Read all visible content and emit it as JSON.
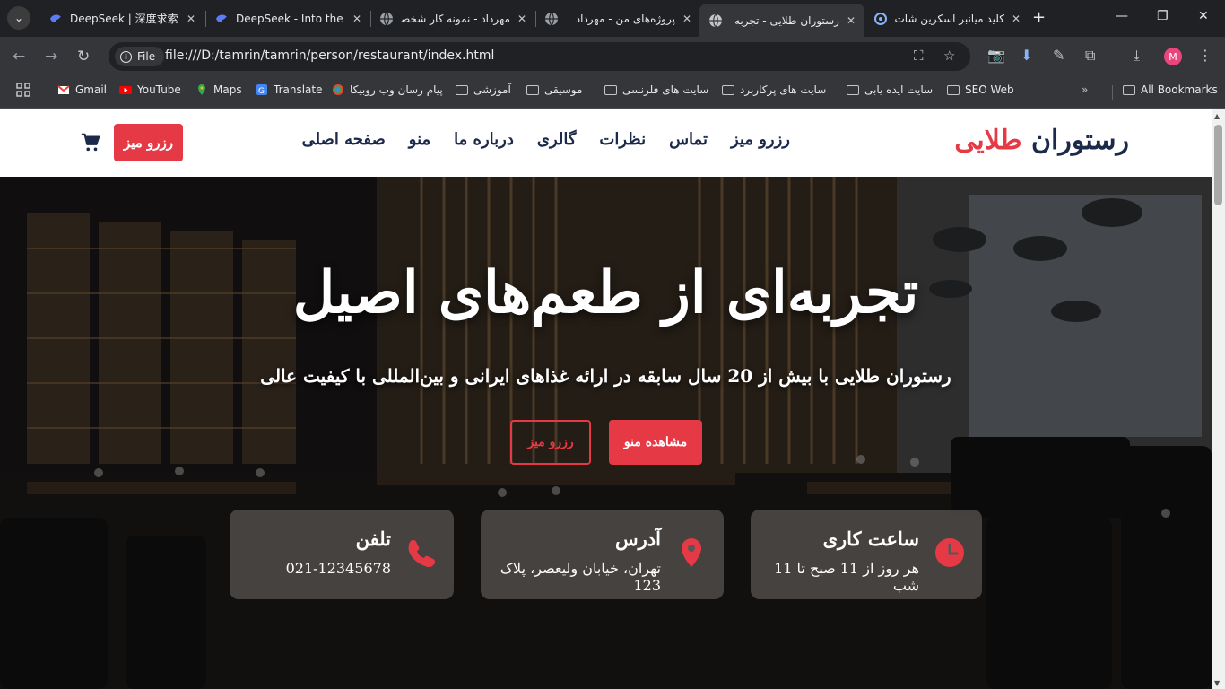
{
  "browser": {
    "tabs": [
      {
        "title": "DeepSeek | 深度求索",
        "icon": "deepseek-icon",
        "active": false
      },
      {
        "title": "DeepSeek - Into the Unknown",
        "icon": "deepseek-icon",
        "active": false
      },
      {
        "title": "مهرداد - نمونه کار شخصی",
        "icon": "globe-icon",
        "active": false
      },
      {
        "title": "پروژه‌های من - مهرداد",
        "icon": "globe-icon",
        "active": false
      },
      {
        "title": "رستوران طلایی - تجربه",
        "icon": "globe-icon",
        "active": true
      },
      {
        "title": "کلید میانبر اسکرین شات",
        "icon": "snip-icon",
        "active": false
      }
    ],
    "url_scheme_label": "File",
    "url": "file:///D:/tamrin/tamrin/person/restaurant/index.html",
    "profile_initial": "M",
    "bookmarks": [
      {
        "label": "Gmail",
        "icon": "gmail-icon"
      },
      {
        "label": "YouTube",
        "icon": "youtube-icon"
      },
      {
        "label": "Maps",
        "icon": "maps-icon"
      },
      {
        "label": "Translate",
        "icon": "translate-icon"
      },
      {
        "label": "پیام رسان وب روبیکا",
        "icon": "rubika-icon"
      },
      {
        "label": "آموزشی",
        "icon": "folder-icon"
      },
      {
        "label": "موسیقی",
        "icon": "folder-icon"
      },
      {
        "label": "سایت های فلرنسی",
        "icon": "folder-icon"
      },
      {
        "label": "سایت های پرکاربرد",
        "icon": "folder-icon"
      },
      {
        "label": "سایت ایده یابی",
        "icon": "folder-icon"
      },
      {
        "label": "SEO Web",
        "icon": "folder-icon"
      }
    ],
    "all_bookmarks": "All Bookmarks"
  },
  "site": {
    "logo_main": "رستوران",
    "logo_accent": "طلایی",
    "nav": [
      "صفحه اصلی",
      "منو",
      "درباره ما",
      "گالری",
      "نظرات",
      "تماس",
      "رزرو میز"
    ],
    "header_reserve": "رزرو میز",
    "hero_title": "تجربه‌ای از طعم‌های اصیل",
    "hero_subtitle": "رستوران طلایی با بیش از 20 سال سابقه در ارائه غذاهای ایرانی و بین‌المللی با کیفیت عالی",
    "btn_menu": "مشاهده منو",
    "btn_reserve": "رزرو میز",
    "cards": [
      {
        "title": "ساعت کاری",
        "text": "هر روز از 11 صبح تا 11 شب",
        "icon": "clock-icon"
      },
      {
        "title": "آدرس",
        "text": "تهران، خیابان ولیعصر، پلاک 123",
        "icon": "location-pin-icon"
      },
      {
        "title": "تلفن",
        "text": "021-12345678",
        "icon": "phone-icon"
      }
    ],
    "accent_color": "#e63946",
    "brand_color": "#1b2a4a"
  }
}
